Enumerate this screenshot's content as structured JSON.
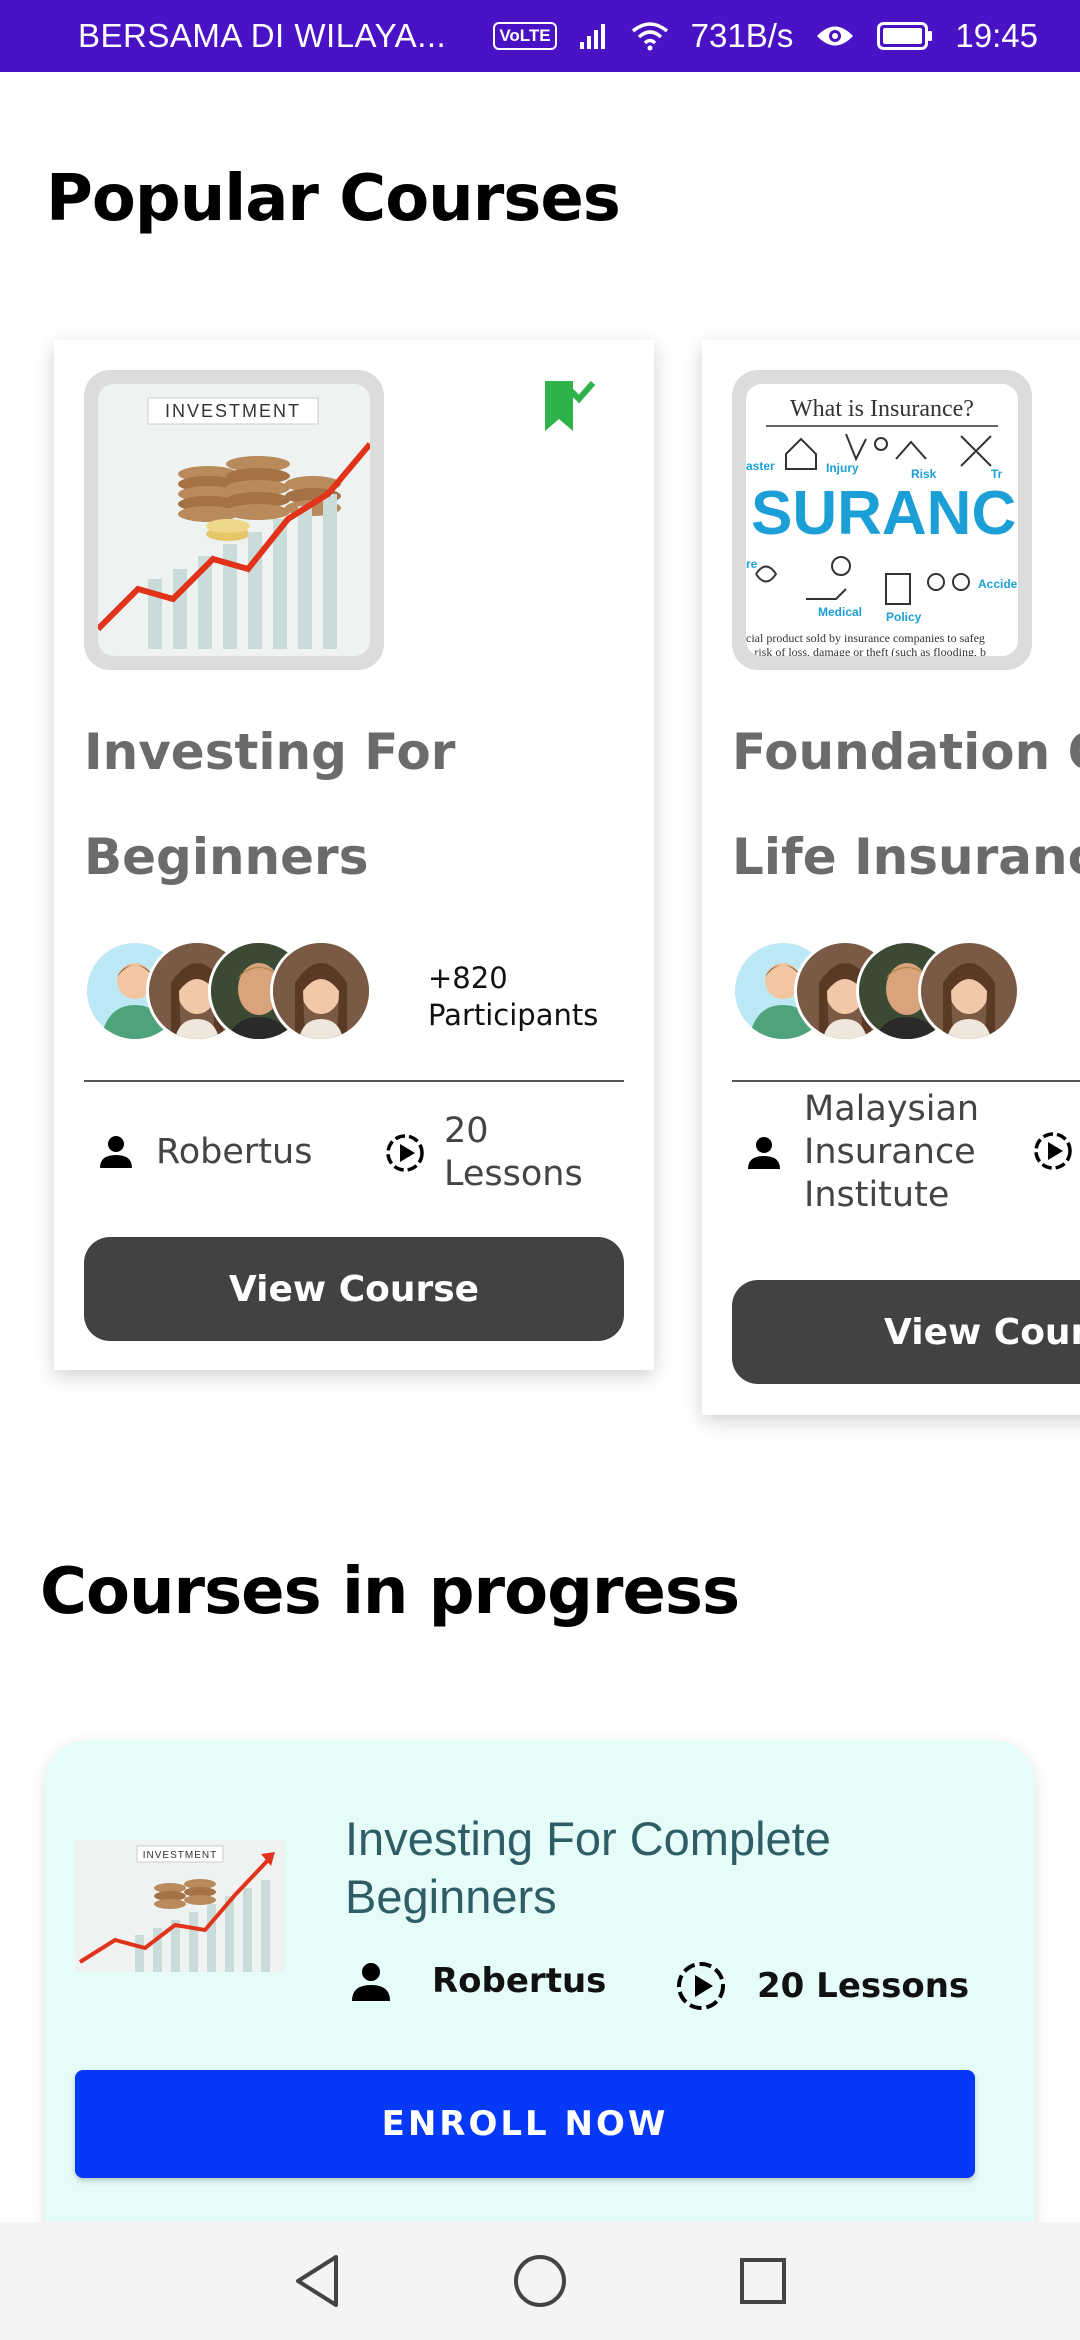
{
  "status_bar": {
    "carrier": "BERSAMA DI WILAYA...",
    "volte": "VoLTE",
    "speed": "731B/s",
    "time": "19:45"
  },
  "popular": {
    "title": "Popular Courses",
    "cards": [
      {
        "thumb_label": "INVESTMENT",
        "name_line1": "Investing For",
        "name_line2": "Beginners",
        "participants_count": "+820",
        "participants_label": "Participants",
        "instructor": "Robertus",
        "lessons_count": "20",
        "lessons_label": "Lessons",
        "button": "View Course",
        "bookmarked": true
      },
      {
        "thumb_title": "What is Insurance?",
        "name_line1": "Foundation O",
        "name_line2": "Life Insuranc",
        "instructor_line1": "Malaysian",
        "instructor_line2": "Insurance",
        "instructor_line3": "Institute",
        "button": "View Cours"
      }
    ]
  },
  "progress": {
    "title": "Courses in progress",
    "card": {
      "thumb_label": "INVESTMENT",
      "title": "Investing For Complete Beginners",
      "instructor": "Robertus",
      "lessons": "20 Lessons",
      "button": "ENROLL NOW"
    }
  },
  "colors": {
    "status_bar": "#4a12c5",
    "bookmark": "#2db34a",
    "view_button": "#424242",
    "enroll_button": "#0638f8",
    "progress_card_bg": "#e6fcf9"
  }
}
